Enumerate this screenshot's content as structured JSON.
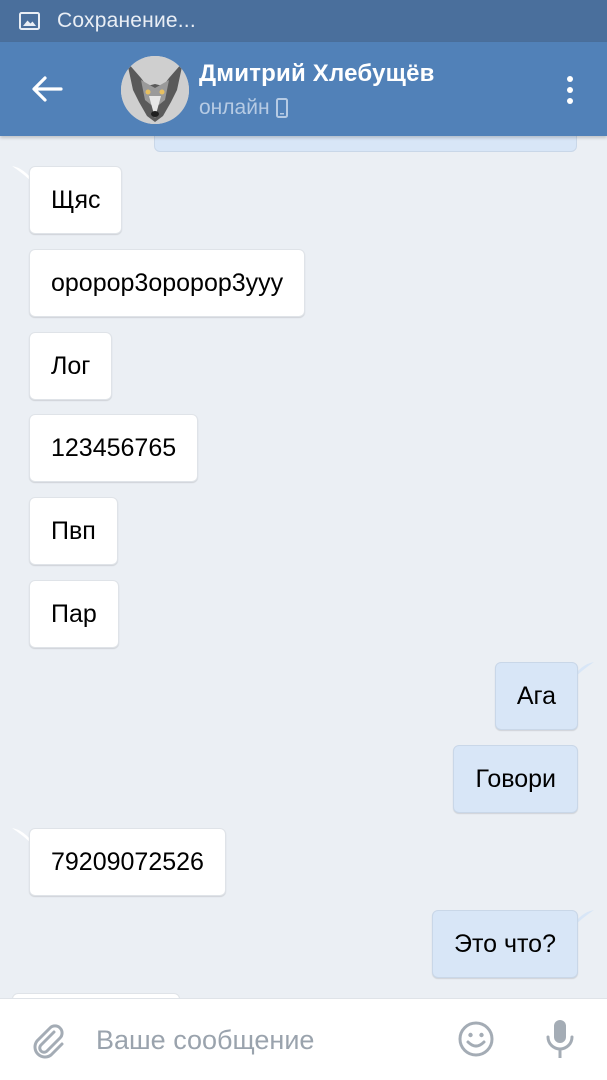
{
  "status_bar": {
    "icon": "image-icon",
    "text": "Сохранение..."
  },
  "header": {
    "back_icon": "arrow-left-icon",
    "contact_name": "Дмитрий Хлебущёв",
    "status": "онлайн",
    "status_icon": "phone-icon",
    "menu_icon": "more-vertical-icon",
    "avatar": "wolf-avatar"
  },
  "messages": [
    {
      "direction": "in",
      "text": "Щяс"
    },
    {
      "direction": "in",
      "text": "оророр3оророр3ууу"
    },
    {
      "direction": "in",
      "text": "Лог"
    },
    {
      "direction": "in",
      "text": "123456765"
    },
    {
      "direction": "in",
      "text": "Пвп"
    },
    {
      "direction": "in",
      "text": "Пар"
    },
    {
      "direction": "out",
      "text": "Ага"
    },
    {
      "direction": "out",
      "text": "Говори"
    },
    {
      "direction": "in",
      "text": "79209072526"
    },
    {
      "direction": "out",
      "text": "Это что?"
    }
  ],
  "composer": {
    "placeholder": "Ваше сообщение",
    "attach_icon": "paperclip-icon",
    "emoji_icon": "smiley-icon",
    "mic_icon": "microphone-icon"
  },
  "colors": {
    "status_bar": "#4a6f9c",
    "header": "#5181b8",
    "background": "#ebeff4",
    "incoming_bubble": "#ffffff",
    "outgoing_bubble": "#d8e6f7"
  }
}
